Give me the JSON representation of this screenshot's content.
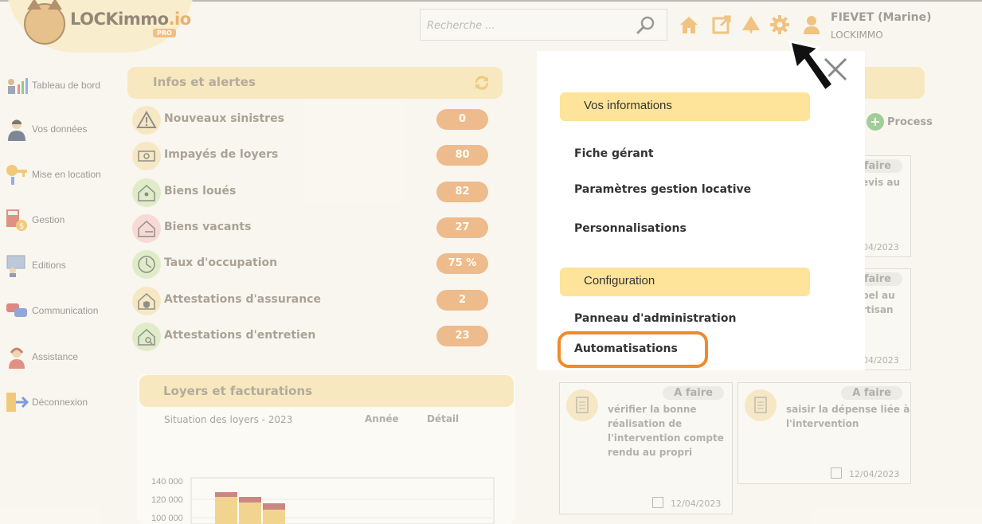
{
  "header": {
    "logo_text": "LOCKimmo",
    "logo_suffix": ".io",
    "logo_badge": "PRO",
    "search_placeholder": "Recherche ...",
    "user_name": "FIEVET (Marine)",
    "user_org": "LOCKIMMO",
    "icons": [
      "home-icon",
      "external-link-icon",
      "alert-icon",
      "gear-icon",
      "user-icon"
    ],
    "accent_color": "#e9a64a"
  },
  "sidebar": {
    "items": [
      {
        "label": "Tableau de bord"
      },
      {
        "label": "Vos données"
      },
      {
        "label": "Mise en location"
      },
      {
        "label": "Gestion"
      },
      {
        "label": "Editions"
      },
      {
        "label": "Communication"
      },
      {
        "label": "Assistance"
      },
      {
        "label": "Déconnexion"
      }
    ]
  },
  "infos": {
    "title": "Infos et alertes",
    "rows": [
      {
        "label": "Nouveaux sinistres",
        "value": "0"
      },
      {
        "label": "Impayés de loyers",
        "value": "80"
      },
      {
        "label": "Biens loués",
        "value": "82"
      },
      {
        "label": "Biens vacants",
        "value": "27"
      },
      {
        "label": "Taux d'occupation",
        "value": "75 %"
      },
      {
        "label": "Attestations d'assurance",
        "value": "2"
      },
      {
        "label": "Attestations d'entretien",
        "value": "23"
      }
    ]
  },
  "loyers": {
    "title": "Loyers et facturations",
    "subtitle": "Situation des loyers - 2023",
    "col_year": "Année",
    "col_detail": "Détail",
    "axis": [
      "140 000",
      "120 000",
      "100 000"
    ]
  },
  "tasks": {
    "process_label": "Process",
    "cards": [
      {
        "badge": "faire",
        "text": "evis au",
        "date": "04/2023"
      },
      {
        "badge": "faire",
        "text": "pel au\nrtisan",
        "date": "04/2023"
      },
      {
        "badge": "A faire",
        "text": "vérifier la bonne\nréalisation de\nl'intervention compte\nrendu au propri",
        "date": "12/04/2023"
      },
      {
        "badge": "A faire",
        "text": "saisir la dépense liée à\nl'intervention",
        "date": "12/04/2023"
      }
    ]
  },
  "menu": {
    "section1": "Vos informations",
    "items1": [
      "Fiche gérant",
      "Paramètres gestion locative",
      "Personnalisations"
    ],
    "section2": "Configuration",
    "items2": [
      "Panneau d'administration",
      "Automatisations"
    ],
    "highlight_color": "#f08a2a",
    "section_color": "#fde49a"
  }
}
